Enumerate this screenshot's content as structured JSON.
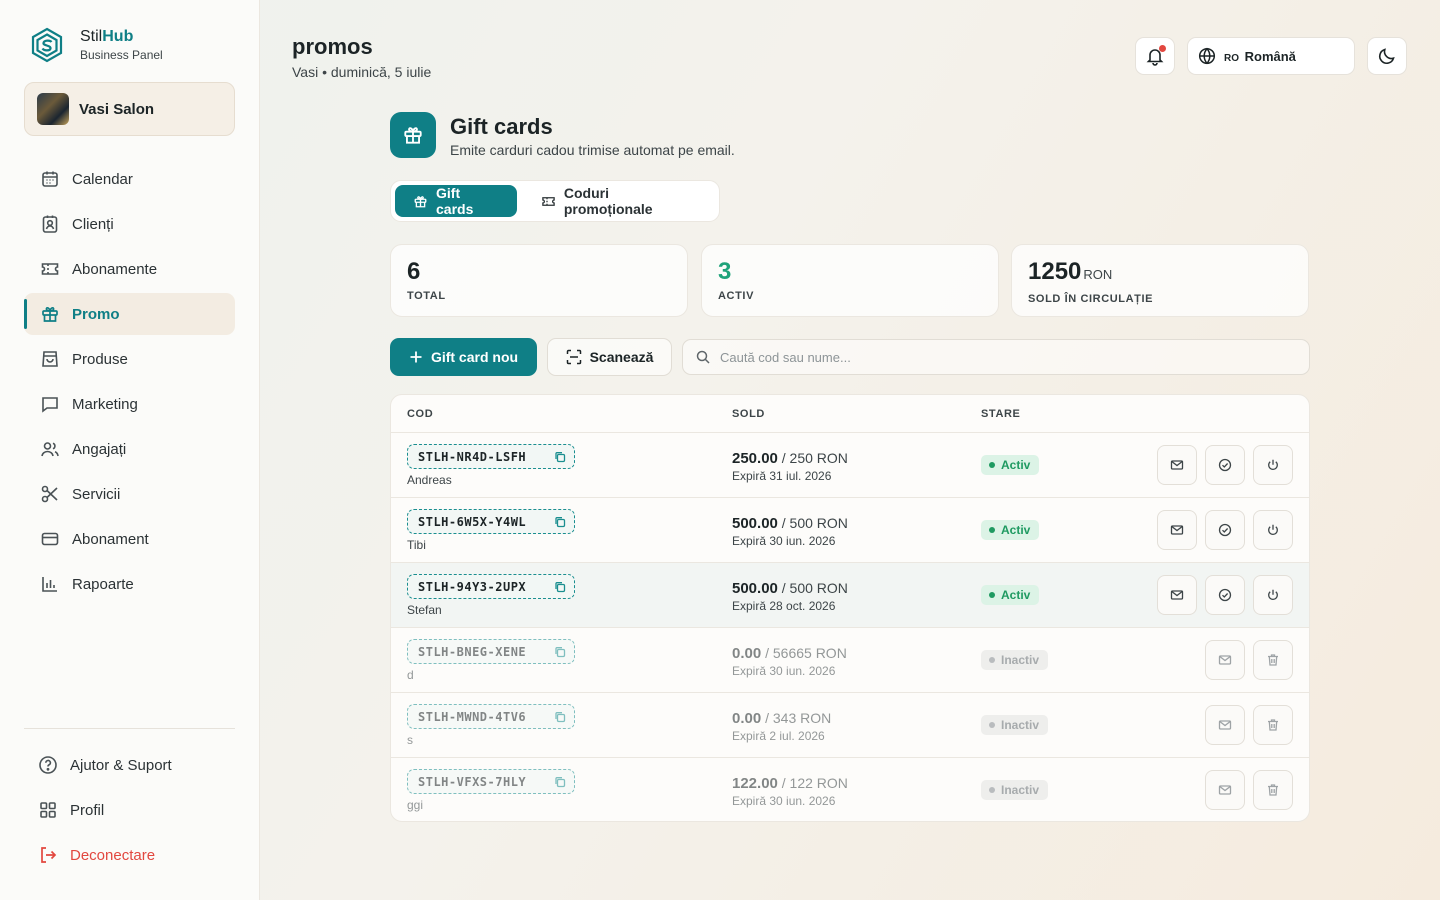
{
  "brand": {
    "name_plain": "Stil",
    "name_bold": "Hub",
    "subtitle": "Business Panel"
  },
  "salon": {
    "name": "Vasi Salon"
  },
  "nav": {
    "items": [
      {
        "label": "Calendar",
        "icon": "calendar-icon"
      },
      {
        "label": "Clienți",
        "icon": "contact-icon"
      },
      {
        "label": "Abonamente",
        "icon": "ticket-icon"
      },
      {
        "label": "Promo",
        "icon": "gift-icon",
        "active": true
      },
      {
        "label": "Produse",
        "icon": "bag-icon"
      },
      {
        "label": "Marketing",
        "icon": "message-icon"
      },
      {
        "label": "Angajați",
        "icon": "users-icon"
      },
      {
        "label": "Servicii",
        "icon": "scissors-icon"
      },
      {
        "label": "Abonament",
        "icon": "card-icon"
      },
      {
        "label": "Rapoarte",
        "icon": "chart-icon"
      }
    ],
    "bottom": [
      {
        "label": "Ajutor & Suport",
        "icon": "help-icon"
      },
      {
        "label": "Profil",
        "icon": "grid-icon"
      },
      {
        "label": "Deconectare",
        "icon": "logout-icon"
      }
    ]
  },
  "header": {
    "title": "promos",
    "subtitle": "Vasi • duminică, 5 iulie",
    "lang_code": "RO",
    "lang_label": "Română"
  },
  "section": {
    "title": "Gift cards",
    "description": "Emite carduri cadou trimise automat pe email."
  },
  "tabs": [
    {
      "label": "Gift cards",
      "active": true
    },
    {
      "label": "Coduri promoționale",
      "active": false
    }
  ],
  "stats": [
    {
      "value": "6",
      "label": "TOTAL"
    },
    {
      "value": "3",
      "label": "ACTIV"
    },
    {
      "value": "1250",
      "unit": "RON",
      "label": "SOLD ÎN CIRCULAȚIE"
    }
  ],
  "actions": {
    "new_label": "Gift card nou",
    "scan_label": "Scanează",
    "search_placeholder": "Caută cod sau nume..."
  },
  "table": {
    "columns": {
      "code": "COD",
      "sold": "SOLD",
      "status": "STARE"
    },
    "rows": [
      {
        "code": "STLH-NR4D-LSFH",
        "owner": "Andreas",
        "balance": "250.00",
        "total": "/ 250 RON",
        "expires": "Expiră 31 iul. 2026",
        "status": "Activ"
      },
      {
        "code": "STLH-6W5X-Y4WL",
        "owner": "Tibi",
        "balance": "500.00",
        "total": "/ 500 RON",
        "expires": "Expiră 30 iun. 2026",
        "status": "Activ"
      },
      {
        "code": "STLH-94Y3-2UPX",
        "owner": "Stefan",
        "balance": "500.00",
        "total": "/ 500 RON",
        "expires": "Expiră 28 oct. 2026",
        "status": "Activ"
      },
      {
        "code": "STLH-BNEG-XENE",
        "owner": "d",
        "balance": "0.00",
        "total": "/ 56665 RON",
        "expires": "Expiră 30 iun. 2026",
        "status": "Inactiv"
      },
      {
        "code": "STLH-MWND-4TV6",
        "owner": "s",
        "balance": "0.00",
        "total": "/ 343 RON",
        "expires": "Expiră 2 iul. 2026",
        "status": "Inactiv"
      },
      {
        "code": "STLH-VFXS-7HLY",
        "owner": "ggi",
        "balance": "122.00",
        "total": "/ 122 RON",
        "expires": "Expiră 30 iun. 2026",
        "status": "Inactiv"
      }
    ]
  },
  "colors": {
    "accent": "#0f7f86",
    "active_green": "#1f9a61",
    "danger": "#e2473f"
  }
}
